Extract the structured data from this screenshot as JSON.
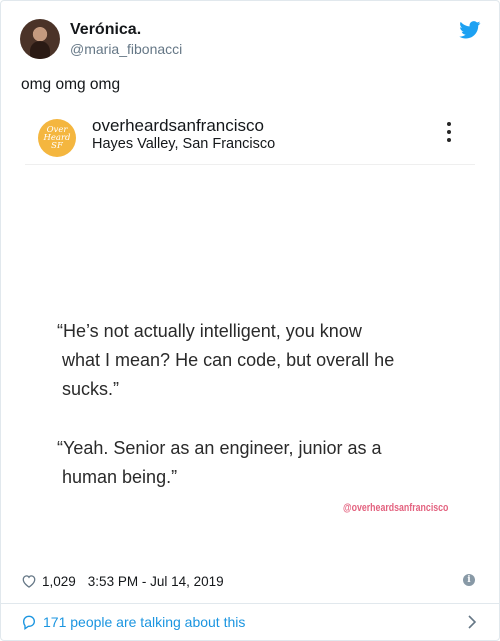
{
  "tweet": {
    "display_name": "Verónica.",
    "handle": "@maria_fibonacci",
    "text": "omg omg omg",
    "likes": "1,029",
    "timestamp": "3:53 PM - Jul 14, 2019",
    "talking_text": "171 people are talking about this"
  },
  "embed": {
    "account_name": "overheardsanfrancisco",
    "location": "Hayes Valley, San Francisco",
    "avatar_text": [
      "Over",
      "Heard",
      "SF"
    ],
    "quote1": "“He’s not actually intelligent, you know\n what I mean? He can code, but overall he\n sucks.”",
    "quote2": "“Yeah. Senior as an engineer, junior as a\n human being.”",
    "watermark": "@overheardsanfrancisco"
  },
  "icons": {
    "brand": "twitter-bird-icon",
    "like": "heart-icon",
    "info": "info-icon",
    "talk": "comment-icon",
    "more": "more-icon",
    "chevron": "chevron-right-icon"
  },
  "colors": {
    "twitter_blue": "#1da1f2",
    "link_blue": "#1b95e0",
    "ig_badge": "#f4b63f",
    "watermark": "#e3627f"
  }
}
